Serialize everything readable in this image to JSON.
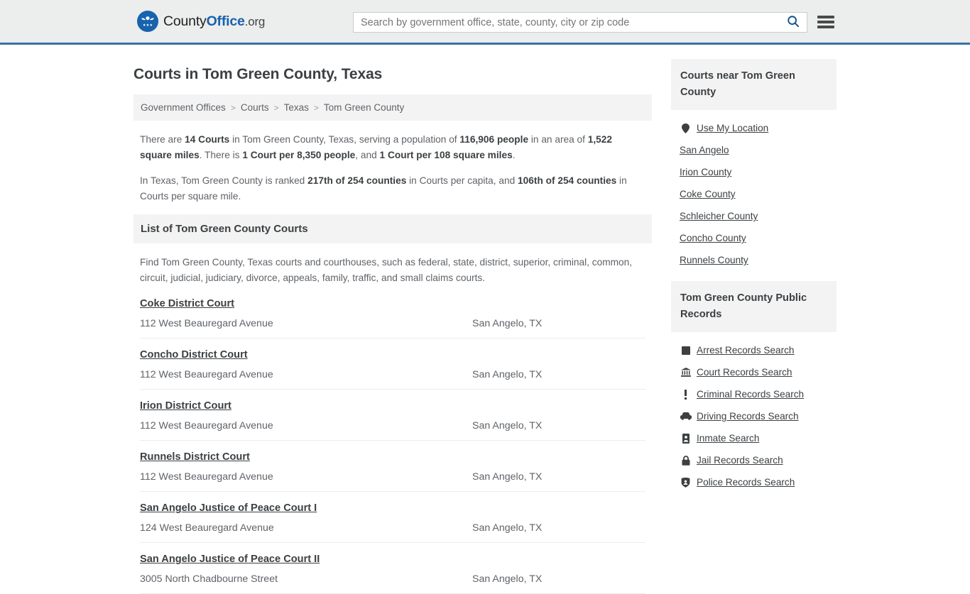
{
  "header": {
    "logo": {
      "name_part1": "County",
      "name_part2": "Office",
      "tld": ".org",
      "badge_color": "#1763ad",
      "icon": "eagle-seal-icon"
    },
    "search": {
      "placeholder": "Search by government office, state, county, city or zip code",
      "value": "",
      "search_icon": "magnifier-icon"
    },
    "menu_icon": "hamburger-menu-icon",
    "accent_color": "#3a72a8",
    "background_color": "#eceded"
  },
  "page": {
    "title": "Courts in Tom Green County, Texas"
  },
  "breadcrumb": {
    "separator": ">",
    "items": [
      {
        "label": "Government Offices"
      },
      {
        "label": "Courts"
      },
      {
        "label": "Texas"
      },
      {
        "label": "Tom Green County"
      }
    ]
  },
  "stats": {
    "paragraph1": [
      {
        "text": "There are ",
        "bold": false
      },
      {
        "text": "14 Courts",
        "bold": true
      },
      {
        "text": " in Tom Green County, Texas, serving a population of ",
        "bold": false
      },
      {
        "text": "116,906 people",
        "bold": true
      },
      {
        "text": " in an area of ",
        "bold": false
      },
      {
        "text": "1,522 square miles",
        "bold": true
      },
      {
        "text": ". There is ",
        "bold": false
      },
      {
        "text": "1 Court per 8,350 people",
        "bold": true
      },
      {
        "text": ", and ",
        "bold": false
      },
      {
        "text": "1 Court per 108 square miles",
        "bold": true
      },
      {
        "text": ".",
        "bold": false
      }
    ],
    "paragraph2": [
      {
        "text": "In Texas, Tom Green County is ranked ",
        "bold": false
      },
      {
        "text": "217th of 254 counties",
        "bold": true
      },
      {
        "text": " in Courts per capita, and ",
        "bold": false
      },
      {
        "text": "106th of 254 counties",
        "bold": true
      },
      {
        "text": " in Courts per square mile.",
        "bold": false
      }
    ]
  },
  "list_section": {
    "heading": "List of Tom Green County Courts",
    "description": "Find Tom Green County, Texas courts and courthouses, such as federal, state, district, superior, criminal, common, circuit, judicial, judiciary, divorce, appeals, family, traffic, and small claims courts.",
    "courts": [
      {
        "name": "Coke District Court",
        "address": "112 West Beauregard Avenue",
        "city": "San Angelo, TX"
      },
      {
        "name": "Concho District Court",
        "address": "112 West Beauregard Avenue",
        "city": "San Angelo, TX"
      },
      {
        "name": "Irion District Court",
        "address": "112 West Beauregard Avenue",
        "city": "San Angelo, TX"
      },
      {
        "name": "Runnels District Court",
        "address": "112 West Beauregard Avenue",
        "city": "San Angelo, TX"
      },
      {
        "name": "San Angelo Justice of Peace Court I",
        "address": "124 West Beauregard Avenue",
        "city": "San Angelo, TX"
      },
      {
        "name": "San Angelo Justice of Peace Court II",
        "address": "3005 North Chadbourne Street",
        "city": "San Angelo, TX"
      }
    ]
  },
  "sidebar": {
    "nearby": {
      "heading": "Courts near Tom Green County",
      "items": [
        {
          "label": "Use My Location",
          "icon": "map-pin-icon"
        },
        {
          "label": "San Angelo",
          "icon": ""
        },
        {
          "label": "Irion County",
          "icon": ""
        },
        {
          "label": "Coke County",
          "icon": ""
        },
        {
          "label": "Schleicher County",
          "icon": ""
        },
        {
          "label": "Concho County",
          "icon": ""
        },
        {
          "label": "Runnels County",
          "icon": ""
        }
      ]
    },
    "public_records": {
      "heading": "Tom Green County Public Records",
      "items": [
        {
          "label": "Arrest Records Search",
          "icon": "fingerprint-icon"
        },
        {
          "label": "Court Records Search",
          "icon": "courthouse-icon"
        },
        {
          "label": "Criminal Records Search",
          "icon": "exclamation-icon"
        },
        {
          "label": "Driving Records Search",
          "icon": "car-icon"
        },
        {
          "label": "Inmate Search",
          "icon": "id-badge-icon"
        },
        {
          "label": "Jail Records Search",
          "icon": "padlock-icon"
        },
        {
          "label": "Police Records Search",
          "icon": "police-badge-icon"
        }
      ]
    }
  }
}
